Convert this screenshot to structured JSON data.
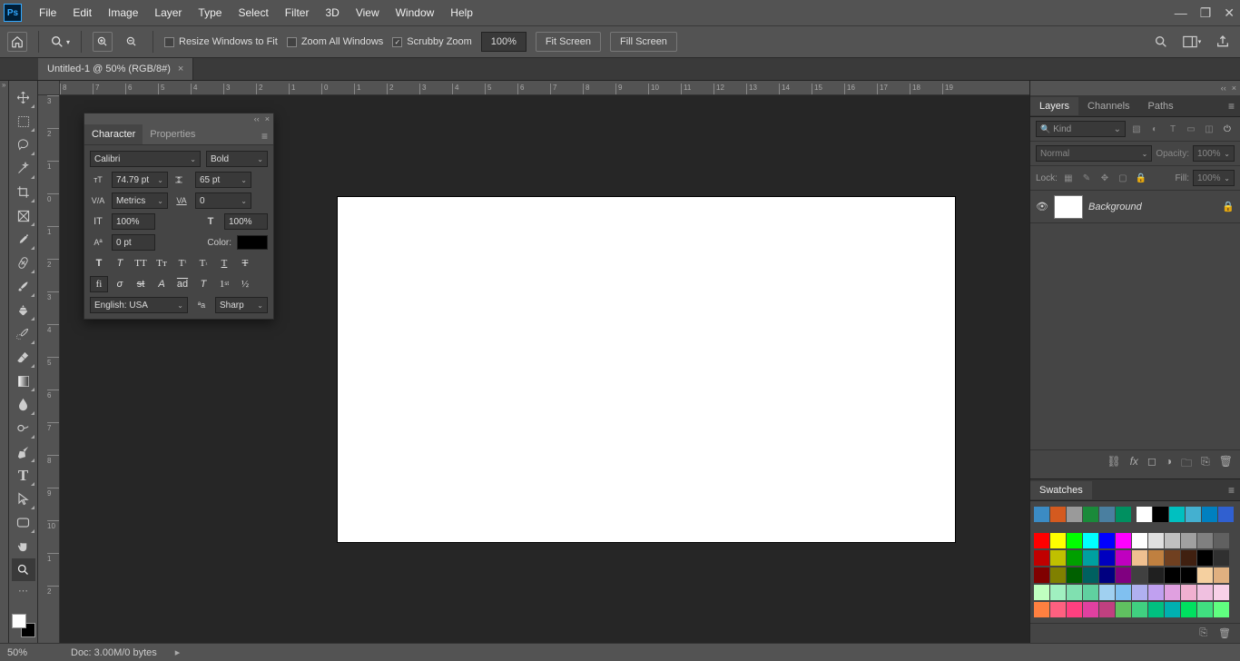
{
  "app": {
    "logo": "Ps"
  },
  "menu": [
    "File",
    "Edit",
    "Image",
    "Layer",
    "Type",
    "Select",
    "Filter",
    "3D",
    "View",
    "Window",
    "Help"
  ],
  "options": {
    "resize_windows": "Resize Windows to Fit",
    "zoom_all": "Zoom All Windows",
    "scrubby": "Scrubby Zoom",
    "zoom_value": "100%",
    "fit_screen": "Fit Screen",
    "fill_screen": "Fill Screen"
  },
  "doc_tab": {
    "title": "Untitled-1 @ 50% (RGB/8#)",
    "close": "×"
  },
  "ruler_h": [
    "8",
    "7",
    "6",
    "5",
    "4",
    "3",
    "2",
    "1",
    "0",
    "1",
    "2",
    "3",
    "4",
    "5",
    "6",
    "7",
    "8",
    "9",
    "10",
    "11",
    "12",
    "13",
    "14",
    "15",
    "16",
    "17",
    "18",
    "19"
  ],
  "ruler_v": [
    "3",
    "2",
    "1",
    "0",
    "1",
    "2",
    "3",
    "4",
    "5",
    "6",
    "7",
    "8",
    "9",
    "10",
    "1",
    "2"
  ],
  "char_panel": {
    "tab1": "Character",
    "tab2": "Properties",
    "font": "Calibri",
    "style": "Bold",
    "size": "74.79 pt",
    "leading": "65 pt",
    "kerning": "Metrics",
    "tracking": "0",
    "vscale": "100%",
    "hscale": "100%",
    "baseline": "0 pt",
    "color_label": "Color:",
    "lang": "English: USA",
    "aa": "Sharp"
  },
  "layers": {
    "tab1": "Layers",
    "tab2": "Channels",
    "tab3": "Paths",
    "kind": "Kind",
    "mode": "Normal",
    "opacity_label": "Opacity:",
    "opacity": "100%",
    "lock_label": "Lock:",
    "fill_label": "Fill:",
    "fill": "100%",
    "bg_layer": "Background"
  },
  "swatches": {
    "title": "Swatches",
    "row1": [
      "#3b8bc4",
      "#d45a1f",
      "#9a9a9a",
      "#1a8a3a",
      "#4a7fa0",
      "#009060"
    ],
    "row1b": [
      "#ffffff",
      "#000000",
      "#00c0c0",
      "#44b0d0",
      "#0080c0",
      "#3060d0"
    ],
    "rows": [
      [
        "#ff0000",
        "#ffff00",
        "#00ff00",
        "#00ffff",
        "#0000ff",
        "#ff00ff",
        "#ffffff",
        "#e0e0e0",
        "#c0c0c0",
        "#a0a0a0",
        "#808080",
        "#606060"
      ],
      [
        "#c00000",
        "#c0c000",
        "#00a000",
        "#00a0a0",
        "#0000c0",
        "#c000c0",
        "#f0c090",
        "#c08040",
        "#704020",
        "#402010",
        "#000000",
        "#303030"
      ],
      [
        "#800000",
        "#808000",
        "#006000",
        "#006060",
        "#000080",
        "#800080",
        "#404040",
        "#202020",
        "#000000",
        "#000000",
        "#f5d0a0",
        "#e0b080"
      ],
      [
        "#c0ffc0",
        "#a0f0c0",
        "#80e0b0",
        "#60d0a0",
        "#a0d0f0",
        "#80c0f0",
        "#b0b0f0",
        "#c0a0f0",
        "#e0a0e0",
        "#f0b0d0",
        "#f0c0e0",
        "#f8d0e8"
      ],
      [
        "#ff8040",
        "#ff6080",
        "#ff4080",
        "#e040a0",
        "#c04080",
        "#60c060",
        "#40d080",
        "#00c080",
        "#00b0b0",
        "#00e060",
        "#40e080",
        "#60ff80"
      ]
    ]
  },
  "status": {
    "zoom": "50%",
    "doc": "Doc: 3.00M/0 bytes"
  }
}
